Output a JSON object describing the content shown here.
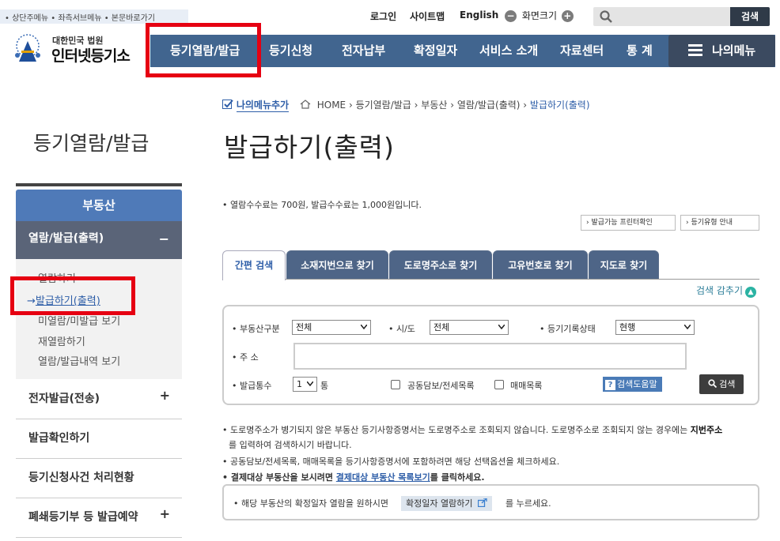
{
  "skip_links": "• 상단주메뉴 • 좌측서브메뉴 • 본문바로가기",
  "logo": {
    "line1": "대한민국 법원",
    "line2": "인터넷등기소"
  },
  "util": {
    "login": "로그인",
    "sitemap": "사이트맵",
    "english": "English",
    "zoom_label": "화면크기",
    "zoom_minus": "−",
    "zoom_plus": "+",
    "search_btn": "검색"
  },
  "gnb": [
    "등기열람/발급",
    "등기신청",
    "전자납부",
    "확정일자",
    "서비스 소개",
    "자료센터",
    "통 계"
  ],
  "my_menu": "나의메뉴",
  "breadcrumb": {
    "add_menu": "나의메뉴추가",
    "path": "HOME › 등기열람/발급 › 부동산 › 열람/발급(출력) › ",
    "current": "발급하기(출력)"
  },
  "page_title": "발급하기(출력)",
  "lnb": {
    "title": "등기열람/발급",
    "head": "부동산",
    "open": "열람/발급(출력)",
    "open_sign": "−",
    "sub": [
      "열람하기",
      "발급하기(출력)",
      "미열람/미발급 보기",
      "재열람하기",
      "열람/발급내역 보기"
    ],
    "active_prefix": "→ ",
    "items": [
      {
        "label": "전자발급(전송)",
        "sign": "+"
      },
      {
        "label": "발급확인하기",
        "sign": ""
      },
      {
        "label": "등기신청사건 처리현황",
        "sign": ""
      },
      {
        "label": "폐쇄등기부 등 발급예약",
        "sign": "+"
      }
    ]
  },
  "notice": "• 열람수수료는 700원, 발급수수료는 1,000원입니다.",
  "small_buttons": [
    "› 발급가능 프린터확인",
    "› 등기유형 안내"
  ],
  "tabs": [
    "간편 검색",
    "소재지번으로 찾기",
    "도로명주소로 찾기",
    "고유번호로 찾기",
    "지도로 찾기"
  ],
  "collapse": "검색 감추기",
  "form": {
    "type_label": "• 부동산구분",
    "type_value": "전체",
    "sido_label": "• 시/도",
    "sido_value": "전체",
    "status_label": "• 등기기록상태",
    "status_value": "현행",
    "addr_label": "• 주 소",
    "count_label": "• 발급통수",
    "count_value": "1",
    "count_unit": "통",
    "chk1": "공동담보/전세목록",
    "chk2": "매매목록",
    "help": "검색도움말",
    "go": "검색"
  },
  "bottom": {
    "l1": "• 도로명주소가 병기되지 않은 부동산 등기사항증명서는 도로명주소로 조회되지 않습니다. 도로명주소로 조회되지 않는 경우에는 ",
    "l1b": "지번주소",
    "l2": "를 입력하여 검색하시기 바랍니다.",
    "l3": "• 공동담보/전세목록, 매매목록을 등기사항증명서에 포함하려면 해당 선택옵션을 체크하세요.",
    "l4a": "• 결제대상 부동산을 보시려면 ",
    "l4link": "결제대상 부동산 목록보기",
    "l4b": "를 클릭하세요."
  },
  "box2": {
    "text": "• 해당 부동산의 확정일자 열람을 원하시면",
    "btn": "확정일자 열람하기",
    "text2": "를 누르세요."
  },
  "colors": {
    "gnb": "#41658f",
    "lnb_head": "#4f7ab8",
    "highlight": "#e60012"
  }
}
